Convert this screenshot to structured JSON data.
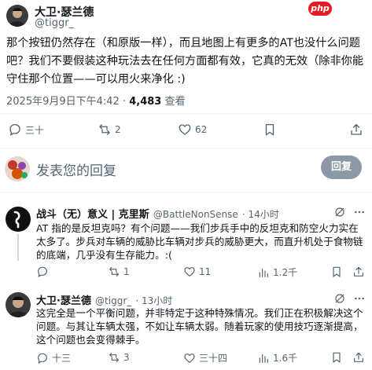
{
  "main_tweet": {
    "name": "大卫·瑟兰德",
    "handle": "@tiggr_",
    "text": "那个按钮仍然存在（和原版一样），而且地图上有更多的AT也没什么问题吧？我们不要假装这种玩法去在任何方面都有效，它真的无效（除非你能守住那个位置——可以用火来净化 :)",
    "timestamp": "2025年9月9日下午4:42 · ",
    "views_count": "4,483",
    "views_label": " 查看",
    "stats": {
      "replies": "三十",
      "reposts": "2",
      "likes": "62"
    }
  },
  "reply_box": {
    "placeholder": "发表您的回复",
    "button_label": "回复"
  },
  "watermark": "php",
  "replies": [
    {
      "name": "战斗（无）意义 | 克里斯",
      "handle": "@BattleNonSense",
      "time": "· 14小时",
      "text": "AT 指的是反坦克吗？有个问题——我们步兵手中的反坦克和防空火力实在太多了。步兵对车辆的威胁比车辆对步兵的威胁更大，而直升机处于食物链的底端，几乎没有生存能力。:(",
      "stats": {
        "replies": "",
        "reposts": "1",
        "likes": "11",
        "views": "1.2千"
      }
    },
    {
      "name": "大卫·瑟兰德",
      "handle": "@tiggr_",
      "time": "· 13小时",
      "text": "这完全是一个平衡问题，并非特定于这种特殊情况。我们正在积极解决这个问题。与其让车辆太强，不如让车辆太弱。随着玩家的使用技巧逐渐提高，这个问题也会变得棘手。",
      "stats": {
        "replies": "十三",
        "reposts": "3",
        "likes": "三十四",
        "views": "1.6千"
      }
    }
  ]
}
